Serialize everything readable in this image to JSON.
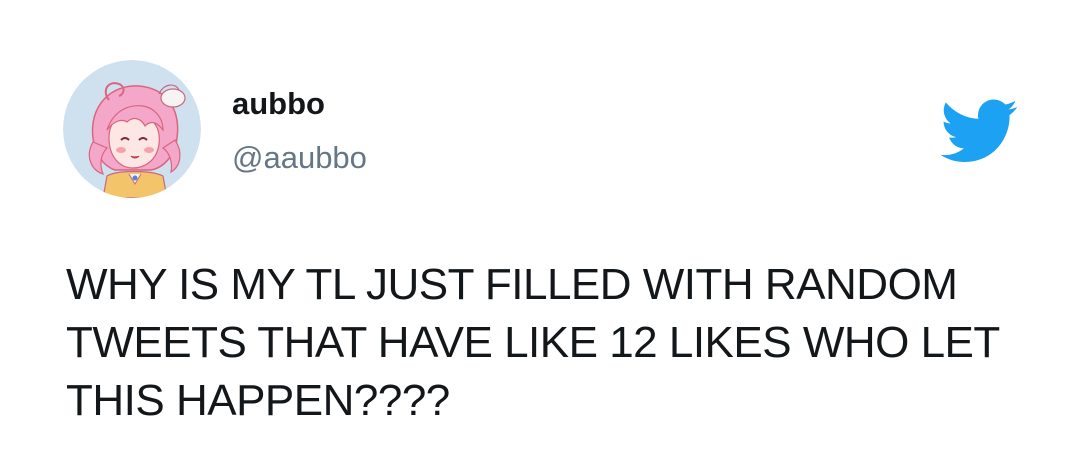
{
  "author": {
    "display_name": "aubbo",
    "handle": "@aaubbo",
    "avatar_icon": "anime-character-avatar"
  },
  "brand": {
    "icon": "twitter-bird-icon",
    "color": "#1da1f2"
  },
  "tweet": {
    "lines": [
      "WHY IS MY TL JUST FILLED WITH RANDOM",
      "TWEETS THAT HAVE LIKE 12 LIKES WHO LET",
      "THIS HAPPEN????"
    ]
  },
  "colors": {
    "name": "#14171a",
    "handle": "#657786",
    "text": "#14171a",
    "avatar_bg": "#cfe0ef",
    "avatar_hair": "#f2a6c7"
  }
}
